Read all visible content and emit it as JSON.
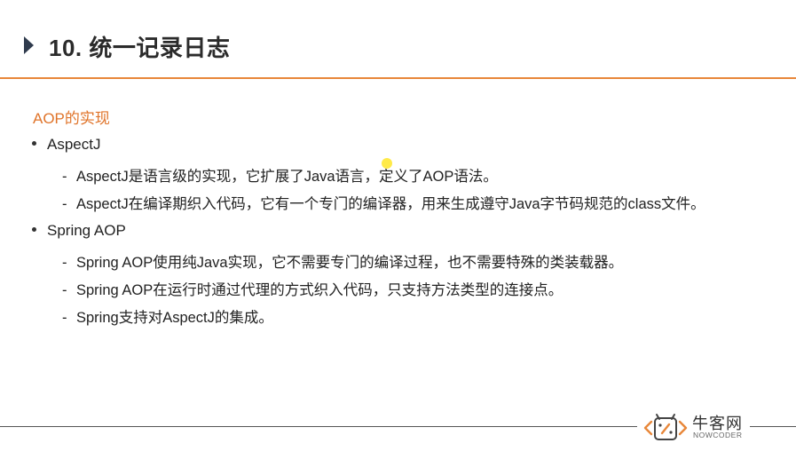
{
  "slide": {
    "title": "10. 统一记录日志",
    "section": "AOP的实现",
    "bullets": [
      {
        "label": "AspectJ",
        "subs": [
          "AspectJ是语言级的实现，它扩展了Java语言，定义了AOP语法。",
          "AspectJ在编译期织入代码，它有一个专门的编译器，用来生成遵守Java字节码规范的class文件。"
        ]
      },
      {
        "label": "Spring AOP",
        "subs": [
          "Spring AOP使用纯Java实现，它不需要专门的编译过程，也不需要特殊的类装载器。",
          "Spring AOP在运行时通过代理的方式织入代码，只支持方法类型的连接点。",
          "Spring支持对AspectJ的集成。"
        ]
      }
    ],
    "dash": "-"
  },
  "logo": {
    "cn": "牛客网",
    "en": "NOWCODER",
    "accent": "#e8873a"
  },
  "colors": {
    "header_line": "#e8873a",
    "section_heading": "#e0742a",
    "header_arrow": "#2f3b4d"
  },
  "icons": {
    "header_marker": "triangle-right-icon",
    "logo_mark": "nowcoder-logo-icon"
  }
}
